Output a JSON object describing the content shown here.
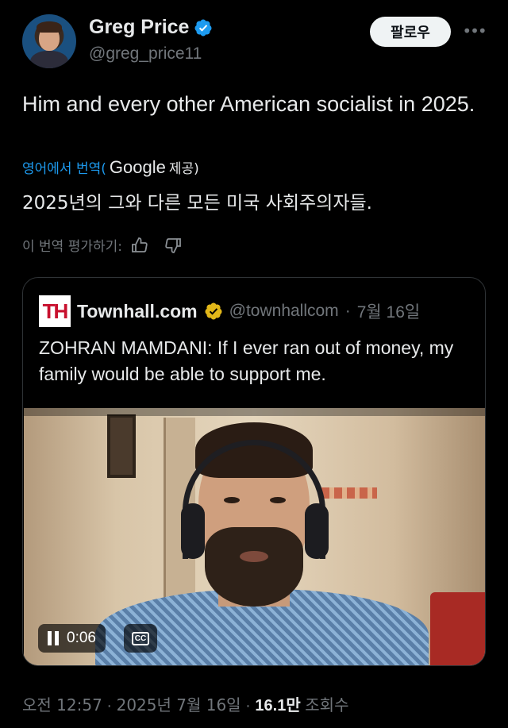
{
  "author": {
    "name": "Greg Price",
    "handle": "@greg_price11",
    "follow_label": "팔로우",
    "more_label": "•••",
    "avatar_icon": "user-avatar"
  },
  "tweet": {
    "text": "Him and every other American socialist in 2025.",
    "translate_prefix": "영어에서 번역(",
    "translate_google": "Google",
    "translate_suffix": "제공)",
    "translated_text": "2025년의 그와 다른 모든 미국 사회주의자들.",
    "rate_label": "이 번역 평가하기:"
  },
  "quote": {
    "logo_text": "TH",
    "name": "Townhall.com",
    "handle": "@townhallcom",
    "separator": "·",
    "date": "7월 16일",
    "text": "ZOHRAN MAMDANI: If I ever ran out of money, my family would be able to support me.",
    "video": {
      "time": "0:06",
      "cc_label": "CC",
      "progress": 0.0
    }
  },
  "meta": {
    "time": "오전 12:57",
    "date": "2025년 7월 16일",
    "separator": "·",
    "views_count": "16.1만",
    "views_label": "조회수"
  },
  "colors": {
    "background": "#000000",
    "link": "#1d9bf0",
    "verified_blue": "#1d9bf0",
    "verified_gold": "#e2b719",
    "muted": "#71767b"
  }
}
